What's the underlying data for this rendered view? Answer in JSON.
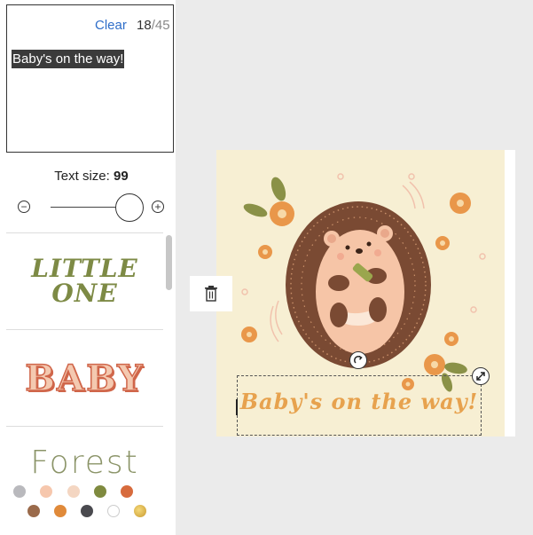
{
  "editor": {
    "clear_label": "Clear",
    "char_count": "18",
    "char_max": "/45",
    "text_value": "Baby's on the way!"
  },
  "text_size": {
    "label": "Text size:",
    "value": "99"
  },
  "styles": [
    {
      "preview_line1": "LITTLE",
      "preview_line2": "ONE"
    },
    {
      "preview": "BABY"
    },
    {
      "preview": "Forest"
    }
  ],
  "palette": {
    "colors": [
      "#b9b9bd",
      "#f6c7ad",
      "#f4d6c2",
      "#7f8a3f",
      "#d76b3d",
      "#9a6a4b",
      "#e08a3a",
      "#4a4a4f",
      "#ffffff",
      "#c99a30"
    ]
  },
  "canvas": {
    "text": "Baby's on the way!",
    "background": "#f7efd3",
    "text_color": "#e7a24e"
  },
  "icons": [
    "trash-icon",
    "rotate-icon",
    "resize-icon",
    "minus-icon",
    "plus-icon"
  ]
}
